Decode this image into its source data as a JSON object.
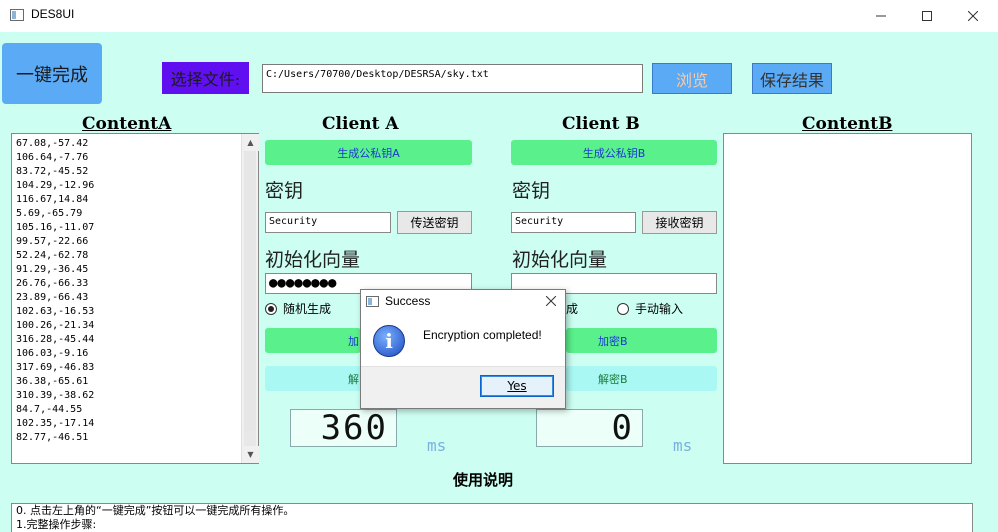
{
  "window": {
    "title": "DES8UI"
  },
  "toolbar": {
    "one_click_label": "一键完成",
    "choose_file_label": "选择文件:",
    "file_path": "C:/Users/70700/Desktop/DESRSA/sky.txt",
    "browse_label": "浏览",
    "save_label": "保存结果"
  },
  "content_a": {
    "heading": "ContentA",
    "lines": [
      "67.08,-57.42",
      "106.64,-7.76",
      "83.72,-45.52",
      "104.29,-12.96",
      "116.67,14.84",
      "5.69,-65.79",
      "105.16,-11.07",
      "99.57,-22.66",
      "52.24,-62.78",
      "91.29,-36.45",
      "26.76,-66.33",
      "23.89,-66.43",
      "102.63,-16.53",
      "100.26,-21.34",
      "316.28,-45.44",
      "106.03,-9.16",
      "317.69,-46.83",
      "36.38,-65.61",
      "310.39,-38.62",
      "84.7,-44.55",
      "102.35,-17.14",
      "82.77,-46.51"
    ]
  },
  "content_b": {
    "heading": "ContentB"
  },
  "client_a": {
    "heading": "Client A",
    "gen_keys_label": "生成公私钥A",
    "key_label": "密钥",
    "key_value": "Security",
    "send_key_label": "传送密钥",
    "iv_label": "初始化向量",
    "iv_value": "●●●●●●●●",
    "radio_random_label": "随机生成",
    "encrypt_label": "加",
    "decrypt_label": "解",
    "time_value": "360",
    "time_unit": "ms"
  },
  "client_b": {
    "heading": "Client B",
    "gen_keys_label": "生成公私钥B",
    "key_label": "密钥",
    "key_value": "Security",
    "receive_key_label": "接收密钥",
    "iv_label": "初始化向量",
    "iv_value": "",
    "radio_random_label": "成",
    "radio_manual_label": "手动输入",
    "encrypt_label": "加密B",
    "decrypt_label": "解密B",
    "time_value": "0",
    "time_unit": "ms"
  },
  "usage": {
    "title": "使用说明",
    "lines": [
      "0. 点击左上角的“一键完成”按钮可以一键完成所有操作。",
      "1.完整操作步骤:"
    ]
  },
  "dialog": {
    "title": "Success",
    "message": "Encryption completed!",
    "yes_label": "Yes"
  }
}
